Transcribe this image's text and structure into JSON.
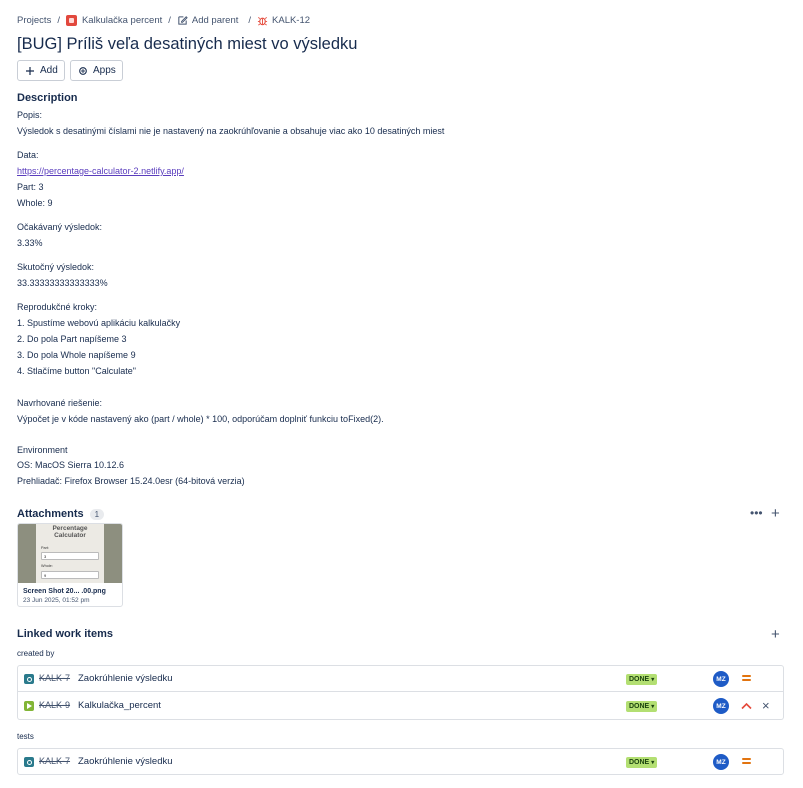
{
  "breadcrumb": {
    "projects": "Projects",
    "project_name": "Kalkulačka percent",
    "add_parent": "Add parent",
    "issue_key": "KALK-12"
  },
  "issue": {
    "title": "[BUG] Príliš veľa desatiných miest vo výsledku"
  },
  "toolbar": {
    "add_label": "Add",
    "apps_label": "Apps"
  },
  "description": {
    "heading": "Description",
    "lines": [
      "Popis:",
      "Výsledok s desatinými číslami nie je nastavený na zaokrúhľovanie a obsahuje viac ako 10 desatiných miest",
      "Data:",
      "https://percentage-calculator-2.netlify.app/",
      "Part: 3",
      "Whole: 9",
      "Očakávaný výsledok:",
      "3.33%",
      "Skutočný výsledok:",
      "33.33333333333333%",
      "Reprodukčné kroky:",
      "1. Spustíme webovú aplikáciu kalkulačky",
      "2. Do pola Part napíšeme 3",
      "3. Do pola Whole napíšeme 9",
      "4. Stlačíme button \"Calculate\"",
      "Navrhované riešenie:",
      "Výpočet je v kóde nastavený ako (part / whole) * 100, odporúčam doplniť funkciu toFixed(2).",
      "Environment",
      "OS: MacOS Sierra 10.12.6",
      "Prehliadač: Firefox Browser 15.24.0esr (64-bitová verzia)"
    ]
  },
  "attachments": {
    "heading": "Attachments",
    "count": "1",
    "more_icon": "more-horizontal-icon",
    "add_icon": "plus-icon",
    "items": [
      {
        "preview_title": "Percentage Calculator",
        "preview_part_label": "Part:",
        "preview_part_value": "3",
        "preview_whole_label": "Whole:",
        "preview_whole_value": "9",
        "name": "Screen Shot 20... .00.png",
        "date": "23 Jun 2025, 01:52 pm"
      }
    ]
  },
  "linked": {
    "heading": "Linked work items",
    "add_icon": "plus-icon",
    "groups": [
      {
        "label": "created by",
        "items": [
          {
            "type": "task",
            "key": "KALK-7",
            "summary": "Zaokrúhlenie výsledku",
            "status": "DONE",
            "assignee": "MZ",
            "priority": "medium"
          },
          {
            "type": "story",
            "key": "KALK-9",
            "summary": "Kalkulačka_percent",
            "status": "DONE",
            "assignee": "MZ",
            "priority": "high",
            "unlink": "×"
          }
        ]
      },
      {
        "label": "tests",
        "items": [
          {
            "type": "task",
            "key": "KALK-7",
            "summary": "Zaokrúhlenie výsledku",
            "status": "DONE",
            "assignee": "MZ",
            "priority": "medium"
          }
        ]
      }
    ]
  },
  "colors": {
    "status_done_bg": "#b3df72",
    "avatar_bg": "#1e5bc6",
    "priority_medium": "#e2740f",
    "priority_high": "#e5493a",
    "link": "#5a3dbd"
  }
}
